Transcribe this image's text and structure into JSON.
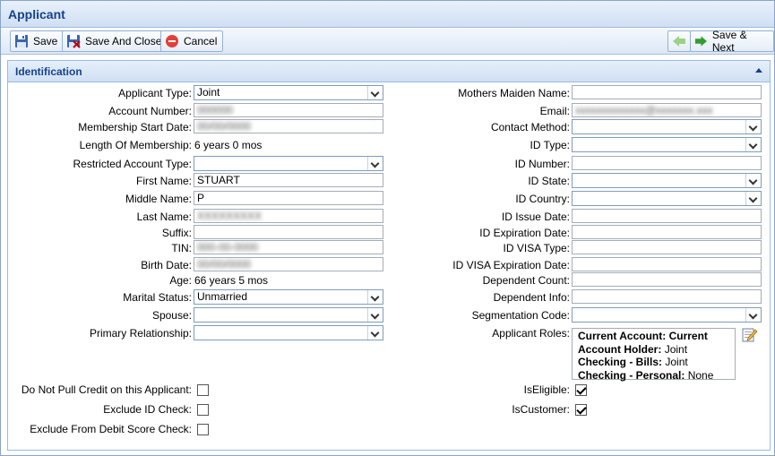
{
  "window": {
    "title": "Applicant"
  },
  "toolbar": {
    "save": "Save",
    "save_and_close": "Save And Close",
    "cancel": "Cancel",
    "save_next": "Save & Next"
  },
  "panel": {
    "title": "Identification"
  },
  "left": {
    "applicant_type": {
      "label": "Applicant Type:",
      "value": "Joint"
    },
    "account_number": {
      "label": "Account Number:",
      "value": "000000"
    },
    "membership_start": {
      "label": "Membership Start Date:",
      "value": "00/00/0000"
    },
    "length_membership": {
      "label": "Length Of Membership:",
      "value": "6 years 0 mos"
    },
    "restricted_account_type": {
      "label": "Restricted Account Type:",
      "value": ""
    },
    "first_name": {
      "label": "First Name:",
      "value": "STUART"
    },
    "middle_name": {
      "label": "Middle Name:",
      "value": "P"
    },
    "last_name": {
      "label": "Last Name:",
      "value": "XXXXXXXXX"
    },
    "suffix": {
      "label": "Suffix:",
      "value": ""
    },
    "tin": {
      "label": "TIN:",
      "value": "000-00-0000"
    },
    "birth_date": {
      "label": "Birth Date:",
      "value": "00/00/0000"
    },
    "age": {
      "label": "Age:",
      "value": "66 years 5 mos"
    },
    "marital_status": {
      "label": "Marital Status:",
      "value": "Unmarried"
    },
    "spouse": {
      "label": "Spouse:",
      "value": ""
    },
    "primary_relationship": {
      "label": "Primary Relationship:",
      "value": ""
    }
  },
  "right": {
    "mothers_maiden": {
      "label": "Mothers Maiden Name:",
      "value": ""
    },
    "email": {
      "label": "Email:",
      "value": "xxxxxxxxxxxxx@xxxxxxx.xxx"
    },
    "contact_method": {
      "label": "Contact Method:",
      "value": ""
    },
    "id_type": {
      "label": "ID Type:",
      "value": ""
    },
    "id_number": {
      "label": "ID Number:",
      "value": ""
    },
    "id_state": {
      "label": "ID State:",
      "value": ""
    },
    "id_country": {
      "label": "ID Country:",
      "value": ""
    },
    "id_issue_date": {
      "label": "ID Issue Date:",
      "value": ""
    },
    "id_expiration_date": {
      "label": "ID Expiration Date:",
      "value": ""
    },
    "id_visa_type": {
      "label": "ID VISA Type:",
      "value": ""
    },
    "id_visa_expiration": {
      "label": "ID VISA Expiration Date:",
      "value": ""
    },
    "dependent_count": {
      "label": "Dependent Count:",
      "value": ""
    },
    "dependent_info": {
      "label": "Dependent Info:",
      "value": ""
    },
    "segmentation_code": {
      "label": "Segmentation Code:",
      "value": ""
    },
    "applicant_roles": {
      "label": "Applicant Roles:",
      "items": [
        {
          "name": "Current Account:",
          "value": "Current"
        },
        {
          "name": "Account Holder:",
          "value": "Joint"
        },
        {
          "name": "Checking - Bills:",
          "value": "Joint"
        },
        {
          "name": "Checking - Personal:",
          "value": "None"
        }
      ]
    }
  },
  "checks": {
    "no_pull_credit": {
      "label": "Do Not Pull Credit on this Applicant:",
      "checked": false
    },
    "exclude_id_check": {
      "label": "Exclude ID Check:",
      "checked": false
    },
    "exclude_debit_score": {
      "label": "Exclude From Debit Score Check:",
      "checked": false
    },
    "is_eligible": {
      "label": "IsEligible:",
      "checked": true
    },
    "is_customer": {
      "label": "IsCustomer:",
      "checked": true
    }
  }
}
